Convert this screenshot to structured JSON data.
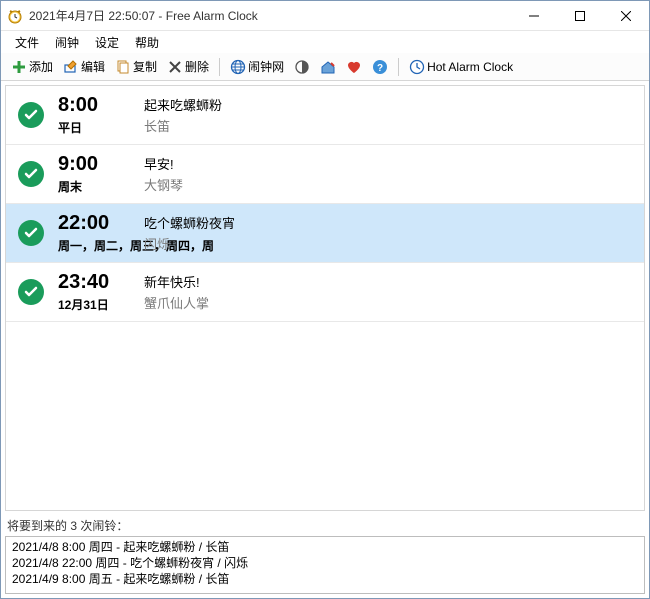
{
  "window": {
    "title": "2021年4月7日 22:50:07 - Free Alarm Clock"
  },
  "menu": {
    "file": "文件",
    "alarm": "闹钟",
    "settings": "设定",
    "help": "帮助"
  },
  "toolbar": {
    "add": "添加",
    "edit": "编辑",
    "copy": "复制",
    "delete": "删除",
    "web": "闹钟网",
    "hot": "Hot Alarm Clock"
  },
  "alarms": [
    {
      "time": "8:00",
      "days": "平日",
      "title": "起来吃螺蛳粉",
      "sub": "长笛",
      "selected": false
    },
    {
      "time": "9:00",
      "days": "周末",
      "title": "早安!",
      "sub": "大钢琴",
      "selected": false
    },
    {
      "time": "22:00",
      "days": "周一，周二，周三，周四，周",
      "title": "吃个螺蛳粉夜宵",
      "sub": "闪烁",
      "selected": true
    },
    {
      "time": "23:40",
      "days": "12月31日",
      "title": "新年快乐!",
      "sub": "蟹爪仙人掌",
      "selected": false
    }
  ],
  "upcoming": {
    "label": "将要到来的 3 次闹铃：",
    "items": [
      "2021/4/8 8:00 周四 - 起来吃螺蛳粉 / 长笛",
      "2021/4/8 22:00 周四 - 吃个螺蛳粉夜宵 / 闪烁",
      "2021/4/9 8:00 周五 - 起来吃螺蛳粉 / 长笛"
    ]
  }
}
